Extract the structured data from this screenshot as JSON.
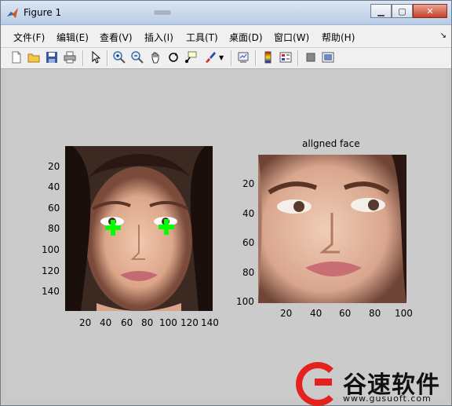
{
  "window": {
    "title": "Figure 1"
  },
  "menu": [
    "文件(F)",
    "编辑(E)",
    "查看(V)",
    "插入(I)",
    "工具(T)",
    "桌面(D)",
    "窗口(W)",
    "帮助(H)"
  ],
  "toolbar": [
    "new-figure",
    "open-file",
    "save-figure",
    "print-figure",
    "edit-plot",
    "zoom-in",
    "zoom-out",
    "pan",
    "rotate-3d",
    "data-cursor",
    "brush",
    "link-plot",
    "colorbar",
    "legend",
    "hide-plot-tools",
    "show-plot-tools"
  ],
  "left_axes": {
    "yticks": [
      "20",
      "40",
      "60",
      "80",
      "100",
      "120",
      "140"
    ],
    "xticks": [
      "20",
      "40",
      "60",
      "80",
      "100",
      "120",
      "140"
    ]
  },
  "right_axes": {
    "title": "allgned face",
    "yticks": [
      "20",
      "40",
      "60",
      "80",
      "100"
    ],
    "xticks": [
      "20",
      "40",
      "60",
      "80",
      "100"
    ]
  },
  "watermark": {
    "cn": "谷速软件",
    "url": "www.gusuoft.com"
  },
  "colors": {
    "marker": "#00ff00",
    "watermark_red": "#e5211c"
  }
}
